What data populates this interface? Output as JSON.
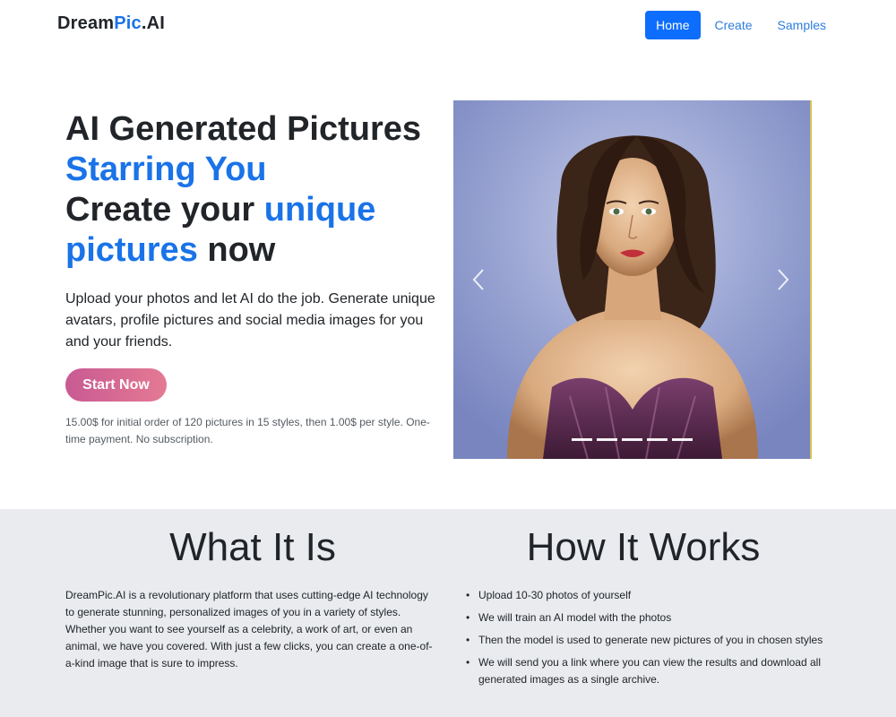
{
  "nav": {
    "brand_part1": "Dream",
    "brand_part2": "Pic",
    "brand_part3": ".AI",
    "links": [
      {
        "label": "Home",
        "active": true
      },
      {
        "label": "Create",
        "active": false
      },
      {
        "label": "Samples",
        "active": false
      }
    ]
  },
  "hero": {
    "line1": "AI Generated Pictures",
    "line2": "Starring You",
    "line3a": "Create your ",
    "line3b": "unique",
    "line4a": "pictures",
    "line4b": " now",
    "description": "Upload your photos and let AI do the job. Generate unique avatars, profile pictures and social media images for you and your friends.",
    "cta_label": "Start Now",
    "price_note": "15.00$ for initial order of 120 pictures in 15 styles, then 1.00$ per style. One-time payment. No subscription."
  },
  "carousel": {
    "slide_count": 5,
    "active_slide": 0,
    "prev_icon": "chevron-left-icon",
    "next_icon": "chevron-right-icon"
  },
  "what_it_is": {
    "title": "What It Is",
    "text": "DreamPic.AI is a revolutionary platform that uses cutting-edge AI technology to generate stunning, personalized images of you in a variety of styles. Whether you want to see yourself as a celebrity, a work of art, or even an animal, we have you covered. With just a few clicks, you can create a one-of-a-kind image that is sure to impress."
  },
  "how_it_works": {
    "title": "How It Works",
    "steps": [
      "Upload 10-30 photos of yourself",
      "We will train an AI model with the photos",
      "Then the model is used to generate new pictures of you in chosen styles",
      "We will send you a link where you can view the results and download all generated images as a single archive."
    ]
  },
  "colors": {
    "accent": "#1a73e8",
    "nav_active_bg": "#0d6efd",
    "cta_gradient_start": "#c85a93",
    "cta_gradient_end": "#e47a93",
    "section_bg": "#e9ebee"
  }
}
